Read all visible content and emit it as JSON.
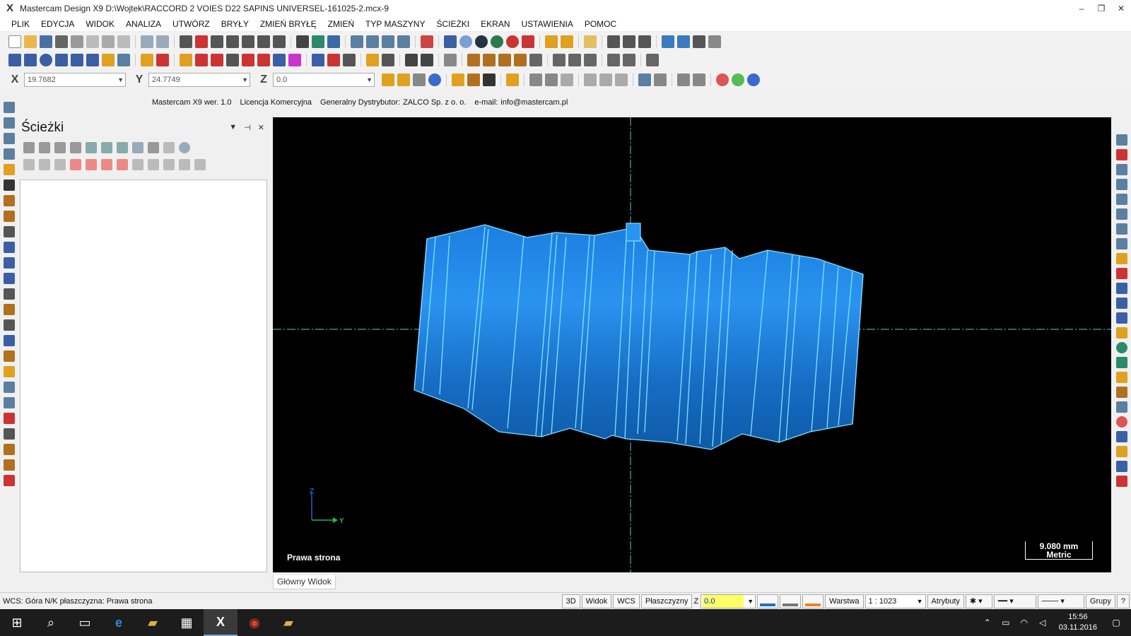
{
  "window": {
    "title": "Mastercam Design X9  D:\\Wojtek\\RACCORD 2 VOIES D22 SAPINS UNIVERSEL-161025-2.mcx-9",
    "logo": "X",
    "minimize": "–",
    "restore": "❐",
    "close": "✕"
  },
  "menu": [
    "PLIK",
    "EDYCJA",
    "WIDOK",
    "ANALIZA",
    "UTWÓRZ",
    "BRYŁY",
    "ZMIEŃ BRYŁĘ",
    "ZMIEŃ",
    "TYP MASZYNY",
    "ŚCIEŻKI",
    "EKRAN",
    "USTAWIENIA",
    "POMOC"
  ],
  "coords": {
    "x_label": "X",
    "x_value": "19.7682",
    "y_label": "Y",
    "y_value": "24.7749",
    "z_label": "Z",
    "z_value": "0.0"
  },
  "info": {
    "version": "Mastercam X9 wer. 1.0",
    "license": "Licencja Komercyjna",
    "distributor_label": "Generalny Dystrybutor:",
    "distributor": "ZALCO Sp. z o. o.",
    "email_label": "e-mail:",
    "email": "info@mastercam.pl"
  },
  "panel": {
    "title": "Ścieżki",
    "dropdown": "▼",
    "pin": "⊣",
    "close": "✕"
  },
  "viewport": {
    "view_name": "Prawa strona",
    "scale_value": "9.080 mm",
    "scale_unit": "Metric",
    "axis_z": "Z",
    "axis_y": "Y",
    "background": "#000000",
    "part_color": "#1a7fd8",
    "edge_color": "#7fe3ff"
  },
  "tabs": [
    "Główny Widok"
  ],
  "status": {
    "text": "WCS: Góra  N/K płaszczyzna: Prawa strona",
    "btn_3d": "3D",
    "btn_widok": "Widok",
    "btn_wcs": "WCS",
    "btn_plaszczyzny": "Płaszczyzny",
    "z_label": "Z",
    "z_value": "0.0",
    "warstwa_label": "Warstwa",
    "warstwa_value": "1 : 1023",
    "atrybuty": "Atrybuty",
    "grupy": "Grupy",
    "help": "?"
  },
  "taskbar": {
    "start_icon": "windows-start-icon",
    "clock_time": "15:56",
    "clock_date": "03.11.2016"
  }
}
